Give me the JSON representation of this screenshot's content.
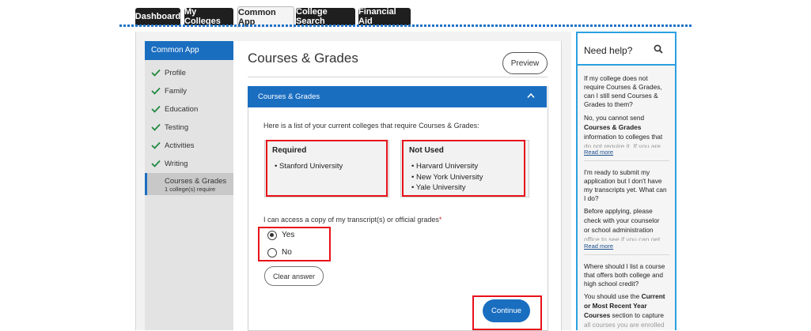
{
  "tabs": [
    "Dashboard",
    "My Colleges",
    "Common App",
    "College Search",
    "Financial Aid"
  ],
  "sidebar": {
    "header": "Common App",
    "items": [
      "Profile",
      "Family",
      "Education",
      "Testing",
      "Activities",
      "Writing"
    ],
    "active_item": "Courses & Grades",
    "active_sub": "1 college(s) require"
  },
  "page": {
    "title": "Courses & Grades",
    "preview_label": "Preview"
  },
  "panel": {
    "header": "Courses & Grades",
    "intro": "Here is a list of your current colleges that require Courses & Grades:",
    "required_title": "Required",
    "required_items": [
      "Stanford University"
    ],
    "not_used_title": "Not Used",
    "not_used_items": [
      "Harvard University",
      "New York University",
      "Yale University"
    ],
    "question": "I can access a copy of my transcript(s) or official grades",
    "required_mark": "*",
    "options": [
      "Yes",
      "No"
    ],
    "selected": "Yes",
    "clear_label": "Clear answer",
    "continue_label": "Continue"
  },
  "help": {
    "title": "Need help?",
    "faqs": [
      {
        "q": "If my college does not require Courses & Grades, can I still send Courses & Grades to them?",
        "a_1": "No, you cannot send",
        "a_2": "Courses & Grades",
        "a_3": "information to colleges that",
        "a_4": "do not require it. If you are",
        "read_more": "Read more"
      },
      {
        "q": "I'm ready to submit my application but I don't have my transcripts yet. What can I do?",
        "a_1": "Before applying, please",
        "a_2": "check with your counselor",
        "a_3": "or school administration",
        "a_4": "office to see if you can get",
        "read_more": "Read more"
      },
      {
        "q": "Where should I list a course that offers both college and high school credit?",
        "a_1": "You should use the",
        "a_2": "Current",
        "a_3": "or Most Recent Year",
        "a_4": "Courses",
        "a_5": "section to capture",
        "a_6": "all courses you are enrolled"
      }
    ]
  },
  "colors": {
    "brand_blue": "#1a6ec0",
    "highlight_red": "#e8111a",
    "help_border": "#2ba0e0"
  }
}
